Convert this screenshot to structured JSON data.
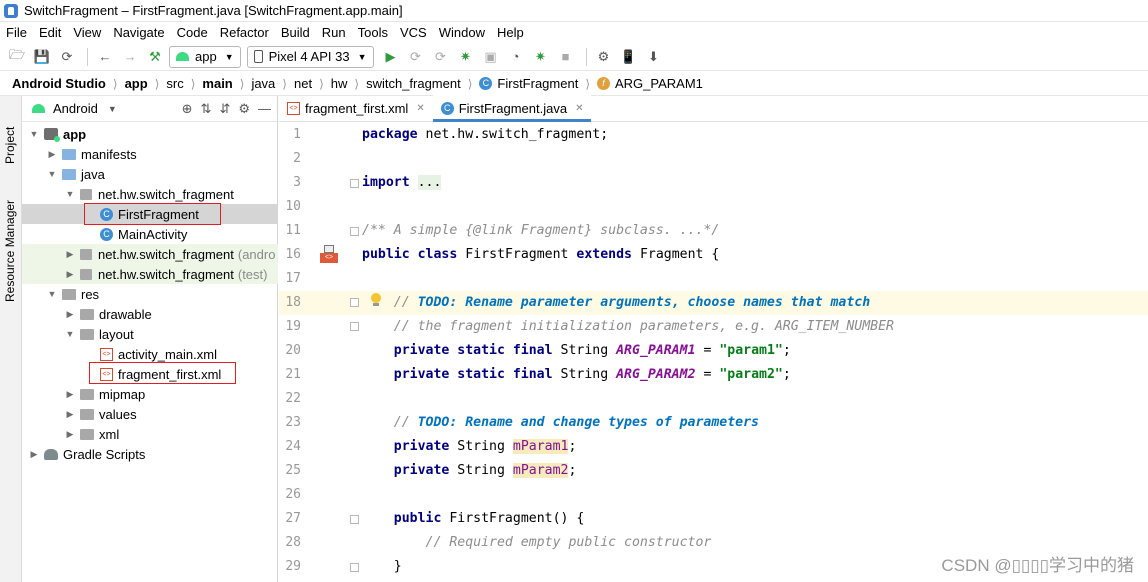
{
  "window": {
    "title": "SwitchFragment – FirstFragment.java [SwitchFragment.app.main]"
  },
  "menu": [
    "File",
    "Edit",
    "View",
    "Navigate",
    "Code",
    "Refactor",
    "Build",
    "Run",
    "Tools",
    "VCS",
    "Window",
    "Help"
  ],
  "toolbar": {
    "run_config": "app",
    "device": "Pixel 4 API 33"
  },
  "breadcrumb": [
    "Android Studio",
    "app",
    "src",
    "main",
    "java",
    "net",
    "hw",
    "switch_fragment",
    "FirstFragment",
    "ARG_PARAM1"
  ],
  "side_tabs": {
    "project": "Project",
    "resource_manager": "Resource Manager"
  },
  "project_panel": {
    "view": "Android",
    "tree": [
      {
        "label": "app"
      },
      {
        "label": "manifests"
      },
      {
        "label": "java"
      },
      {
        "label": "net.hw.switch_fragment"
      },
      {
        "label": "FirstFragment"
      },
      {
        "label": "MainActivity"
      },
      {
        "label": "net.hw.switch_fragment",
        "suffix": "(andro"
      },
      {
        "label": "net.hw.switch_fragment",
        "suffix": "(test)"
      },
      {
        "label": "res"
      },
      {
        "label": "drawable"
      },
      {
        "label": "layout"
      },
      {
        "label": "activity_main.xml"
      },
      {
        "label": "fragment_first.xml"
      },
      {
        "label": "mipmap"
      },
      {
        "label": "values"
      },
      {
        "label": "xml"
      },
      {
        "label": "Gradle Scripts"
      }
    ]
  },
  "editor": {
    "tabs": [
      "fragment_first.xml",
      "FirstFragment.java"
    ],
    "active_tab": "FirstFragment.java",
    "line_numbers": [
      "1",
      "2",
      "3",
      "10",
      "11",
      "16",
      "17",
      "18",
      "19",
      "20",
      "21",
      "22",
      "23",
      "24",
      "25",
      "26",
      "27",
      "28",
      "29"
    ],
    "code": {
      "l1_kw": "package",
      "l1_rest": " net.hw.switch_fragment;",
      "l3_kw": "import",
      "l3_fold": "...",
      "l11_doc": "/** A simple {@link Fragment} subclass. ...*/",
      "l16_kw1": "public",
      "l16_kw2": "class",
      "l16_name": "FirstFragment",
      "l16_kw3": "extends",
      "l16_rest": "Fragment {",
      "l18_prefix": "// ",
      "l18_todo": "TODO: Rename parameter arguments, choose names that match",
      "l19_cmt": "// the fragment initialization parameters, e.g. ARG_ITEM_NUMBER",
      "l20_kw": "private static final",
      "l20_type": "String",
      "l20_field": "ARG_PARAM1",
      "l20_eq": " = ",
      "l20_str": "\"param1\"",
      "l20_end": ";",
      "l21_kw": "private static final",
      "l21_type": "String",
      "l21_field": "ARG_PARAM2",
      "l21_eq": " = ",
      "l21_str": "\"param2\"",
      "l21_end": ";",
      "l23_prefix": "// ",
      "l23_todo": "TODO: Rename and change types of parameters",
      "l24_kw": "private",
      "l24_type": "String",
      "l24_field": "mParam1",
      "l24_end": ";",
      "l25_kw": "private",
      "l25_type": "String",
      "l25_field": "mParam2",
      "l25_end": ";",
      "l27_kw": "public",
      "l27_rest": "FirstFragment() {",
      "l28_cmt": "// Required empty public constructor",
      "l29": "}"
    }
  },
  "watermark": "CSDN @▯▯▯▯学习中的猪"
}
